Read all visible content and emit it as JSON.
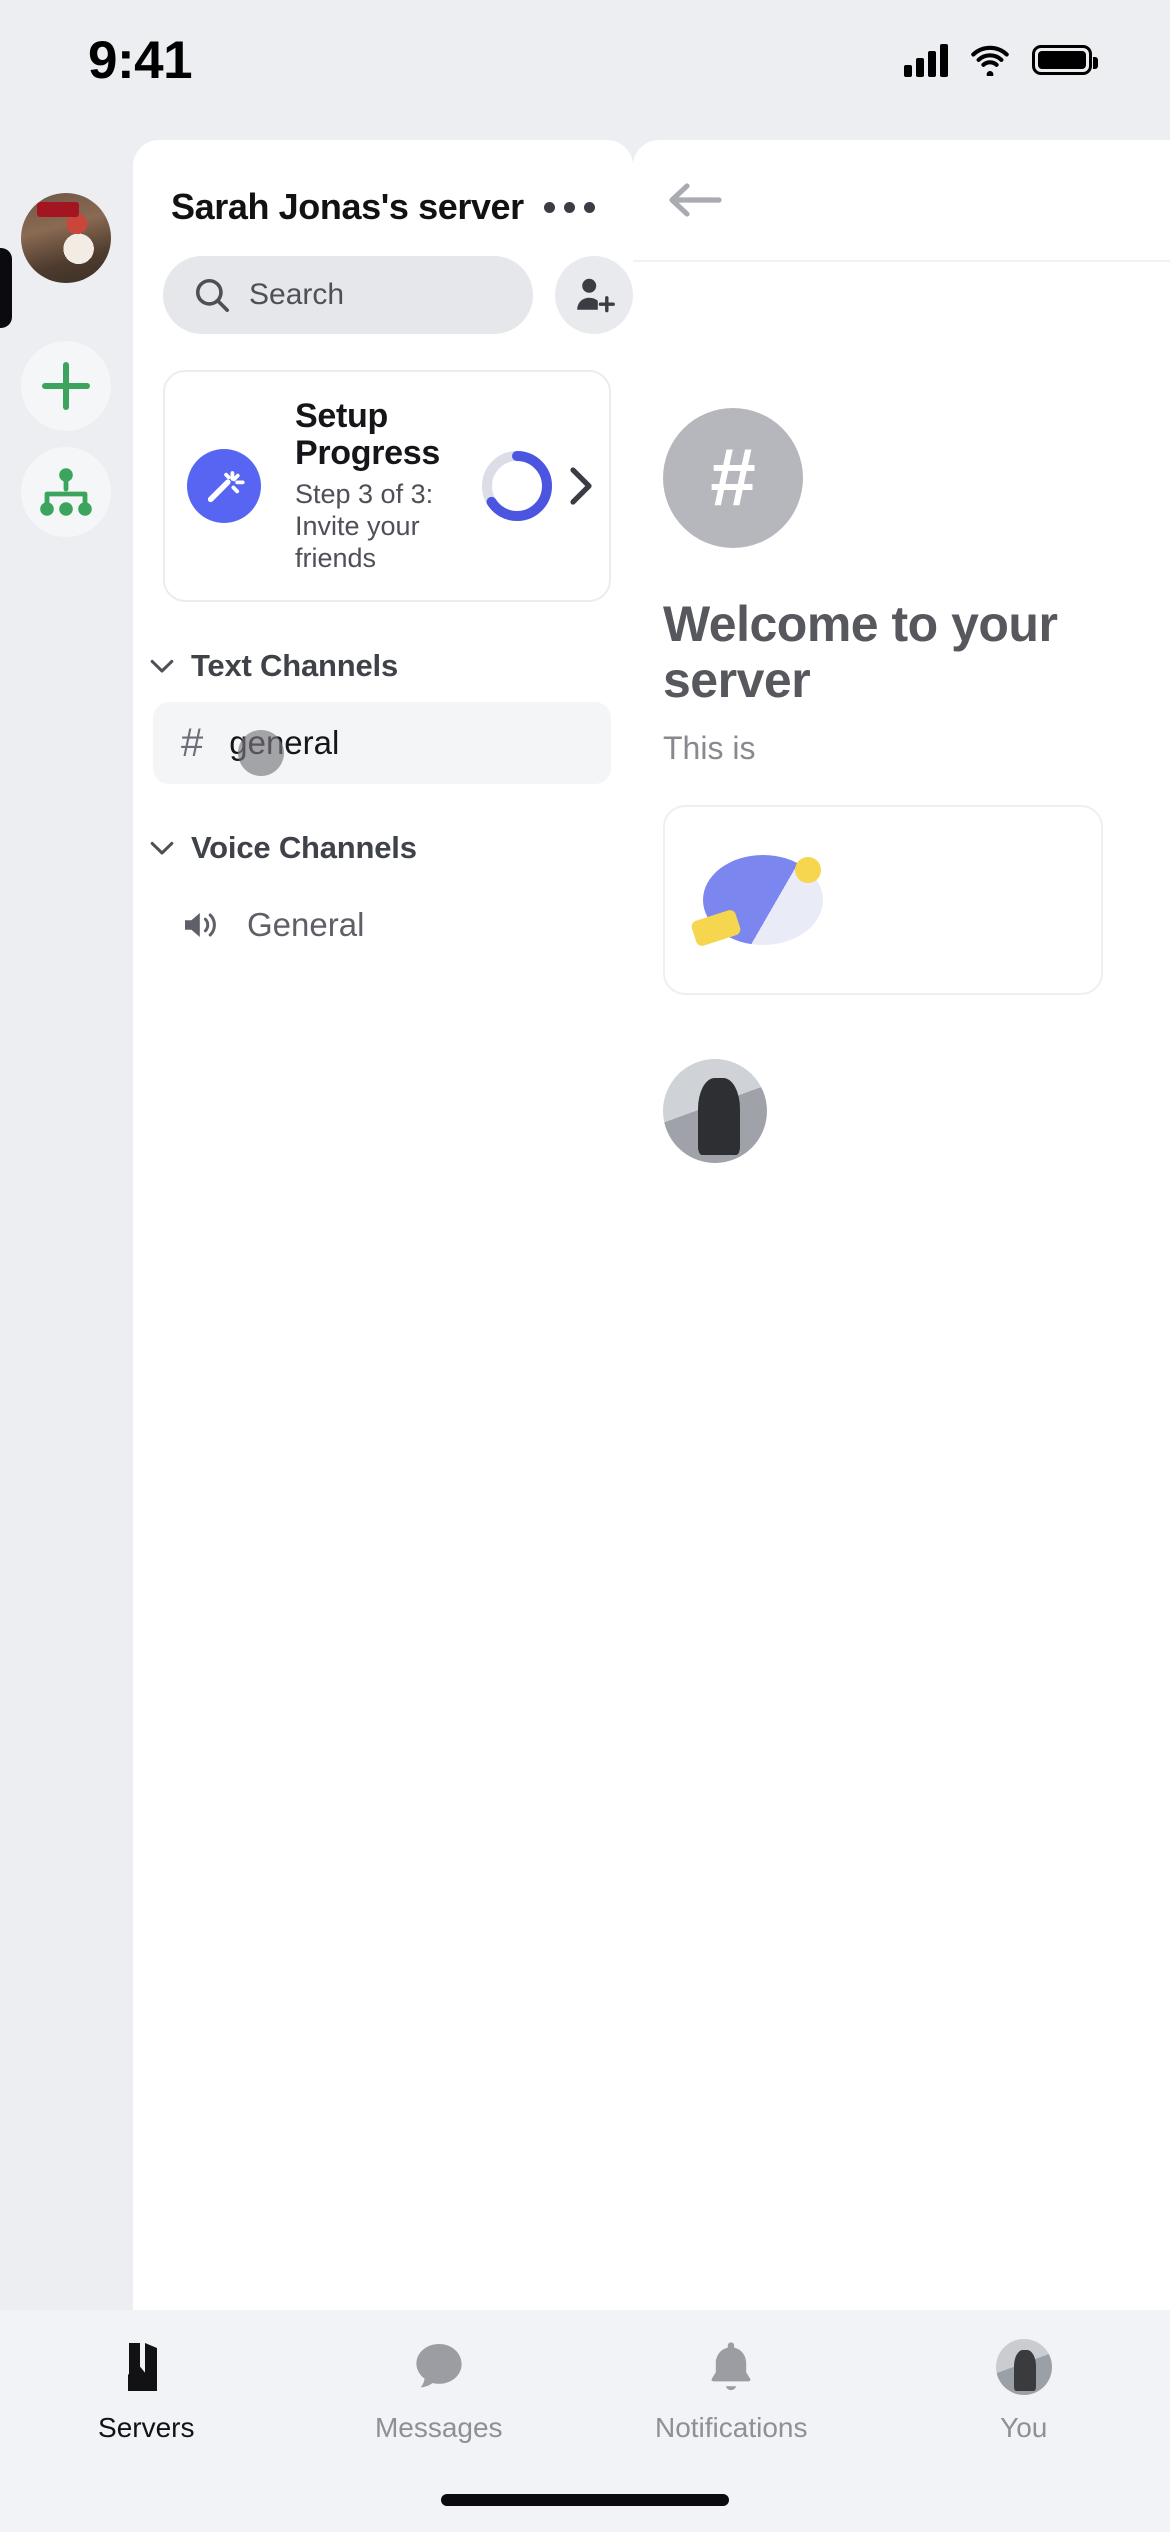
{
  "status_bar": {
    "time": "9:41",
    "cellular_icon": "cellular-signal-icon",
    "wifi_icon": "wifi-icon",
    "battery_icon": "battery-full-icon"
  },
  "server_rail": {
    "items": [
      {
        "name": "sarah-jonas-server-avatar",
        "type": "server-avatar",
        "active": "true"
      },
      {
        "name": "add-server-button",
        "type": "plus",
        "color": "#3ba55d"
      },
      {
        "name": "explore-servers-button",
        "type": "hierarchy",
        "color": "#3ba55d"
      }
    ]
  },
  "channel_panel": {
    "title": "Sarah Jonas's server",
    "more_options_icon": "more-horizontal-icon",
    "search": {
      "placeholder": "Search",
      "icon": "search-icon"
    },
    "invite_button_icon": "person-add-icon",
    "setup_card": {
      "icon": "magic-wand-icon",
      "icon_bg": "#5865f2",
      "title": "Setup Progress",
      "subtitle": "Step 3 of 3: Invite your friends",
      "progress_percent": 66,
      "progress_color": "#4b55e0",
      "progress_track_color": "#dcdde6",
      "chevron_icon": "chevron-right-icon"
    },
    "sections": [
      {
        "label": "Text Channels",
        "collapse_icon": "chevron-down-icon",
        "channels": [
          {
            "name": "general",
            "icon": "hash-icon",
            "selected": "true"
          }
        ]
      },
      {
        "label": "Voice Channels",
        "collapse_icon": "chevron-down-icon",
        "channels": [
          {
            "name": "General",
            "icon": "speaker-icon",
            "selected": "false"
          }
        ]
      }
    ]
  },
  "right_panel": {
    "back_icon": "arrow-left-icon",
    "channel_badge": "#",
    "welcome_title": "Welcome to your server",
    "welcome_sub": "This is",
    "card_icon": "rocket-icon",
    "message_avatar": "user-avatar"
  },
  "tab_bar": {
    "tabs": [
      {
        "label": "Servers",
        "icon": "servers-icon",
        "active": "true"
      },
      {
        "label": "Messages",
        "icon": "chat-bubble-icon",
        "active": "false"
      },
      {
        "label": "Notifications",
        "icon": "bell-icon",
        "active": "false"
      },
      {
        "label": "You",
        "icon": "user-avatar-icon",
        "active": "false"
      }
    ]
  },
  "cursor": {
    "name": "touch-indicator"
  },
  "home_indicator": {
    "name": "home-indicator"
  }
}
